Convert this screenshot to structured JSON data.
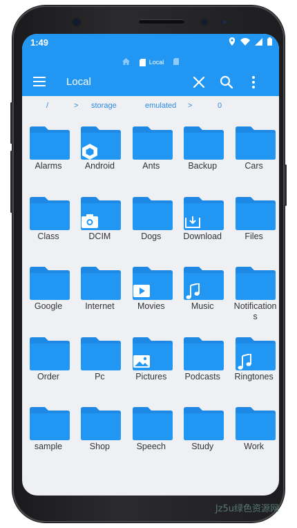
{
  "status_bar": {
    "time": "1:49"
  },
  "header": {
    "tabs": [
      {
        "label": "",
        "icon": "home-icon"
      },
      {
        "label": "Local",
        "icon": "phone-storage-icon"
      },
      {
        "label": "",
        "icon": "sd-card-icon"
      }
    ],
    "title": "Local",
    "actions": [
      "close-icon",
      "search-icon",
      "more-vert-icon"
    ]
  },
  "path": {
    "segments": [
      "/",
      ">",
      "storage",
      "emulated",
      ">",
      "0"
    ]
  },
  "folders": [
    {
      "name": "Alarms",
      "badge": ""
    },
    {
      "name": "Android",
      "badge": "android-hex-icon"
    },
    {
      "name": "Ants",
      "badge": ""
    },
    {
      "name": "Backup",
      "badge": ""
    },
    {
      "name": "Cars",
      "badge": ""
    },
    {
      "name": "Class",
      "badge": ""
    },
    {
      "name": "DCIM",
      "badge": "camera-icon"
    },
    {
      "name": "Dogs",
      "badge": ""
    },
    {
      "name": "Download",
      "badge": "download-icon"
    },
    {
      "name": "Files",
      "badge": ""
    },
    {
      "name": "Google",
      "badge": ""
    },
    {
      "name": "Internet",
      "badge": ""
    },
    {
      "name": "Movies",
      "badge": "play-icon"
    },
    {
      "name": "Music",
      "badge": "music-note-icon"
    },
    {
      "name": "Notifications",
      "badge": ""
    },
    {
      "name": "Order",
      "badge": ""
    },
    {
      "name": "Pc",
      "badge": ""
    },
    {
      "name": "Pictures",
      "badge": "image-icon"
    },
    {
      "name": "Podcasts",
      "badge": ""
    },
    {
      "name": "Ringtones",
      "badge": "music-note-icon"
    },
    {
      "name": "sample",
      "badge": ""
    },
    {
      "name": "Shop",
      "badge": ""
    },
    {
      "name": "Speech",
      "badge": ""
    },
    {
      "name": "Study",
      "badge": ""
    },
    {
      "name": "Work",
      "badge": ""
    }
  ],
  "colors": {
    "accent": "#2196f3",
    "folder": "#2196f3",
    "folder_tab": "#1e88e5",
    "path_text": "#2f8ae6",
    "screen_bg": "#eef0f3"
  },
  "watermark": "Jz5u绿色资源网"
}
